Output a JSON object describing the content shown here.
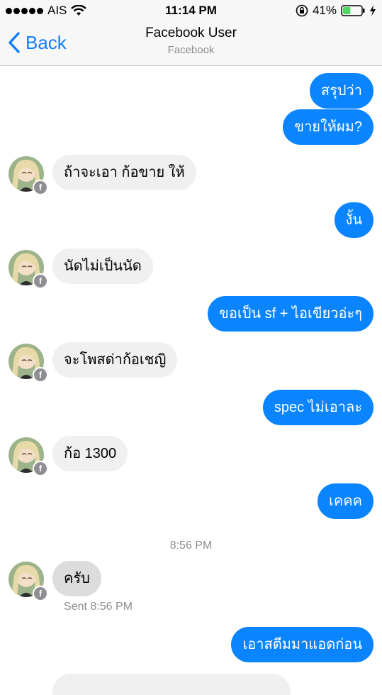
{
  "status_bar": {
    "carrier": "AIS",
    "time": "11:14 PM",
    "battery": "41%",
    "signal_bars": 5,
    "battery_level": 0.41,
    "icons": [
      "wifi-icon",
      "rotation-lock-icon",
      "battery-icon",
      "charging-icon"
    ]
  },
  "nav": {
    "back_label": "Back",
    "title": "Facebook User",
    "subtitle": "Facebook"
  },
  "messages": [
    {
      "side": "out",
      "text": "สรุปว่า"
    },
    {
      "side": "out",
      "text": "ขายให้ผม?"
    },
    {
      "side": "in",
      "text": "ถ้าจะเอา ก้อขาย ให้"
    },
    {
      "side": "out",
      "text": "งั้น"
    },
    {
      "side": "in",
      "text": "นัดไม่เป็นนัด"
    },
    {
      "side": "out",
      "text": "ขอเป็น sf + ไอเขียวอ่ะๆ"
    },
    {
      "side": "in",
      "text": "จะโพสด่าก้อเชญิ"
    },
    {
      "side": "out",
      "text": "spec ไม่เอาละ"
    },
    {
      "side": "in",
      "text": "ก้อ 1300"
    },
    {
      "side": "out",
      "text": "เคคค"
    },
    {
      "side": "in",
      "text": "ครับ"
    },
    {
      "side": "out",
      "text": "เอาสตีมมาแอดก่อน"
    }
  ],
  "timestamp": "8:56 PM",
  "sent_note": "Sent 8:56 PM",
  "fb_badge": "f",
  "colors": {
    "outgoing_bubble": "#0a84ff",
    "incoming_bubble": "#f0f0f0",
    "accent": "#147efb"
  }
}
